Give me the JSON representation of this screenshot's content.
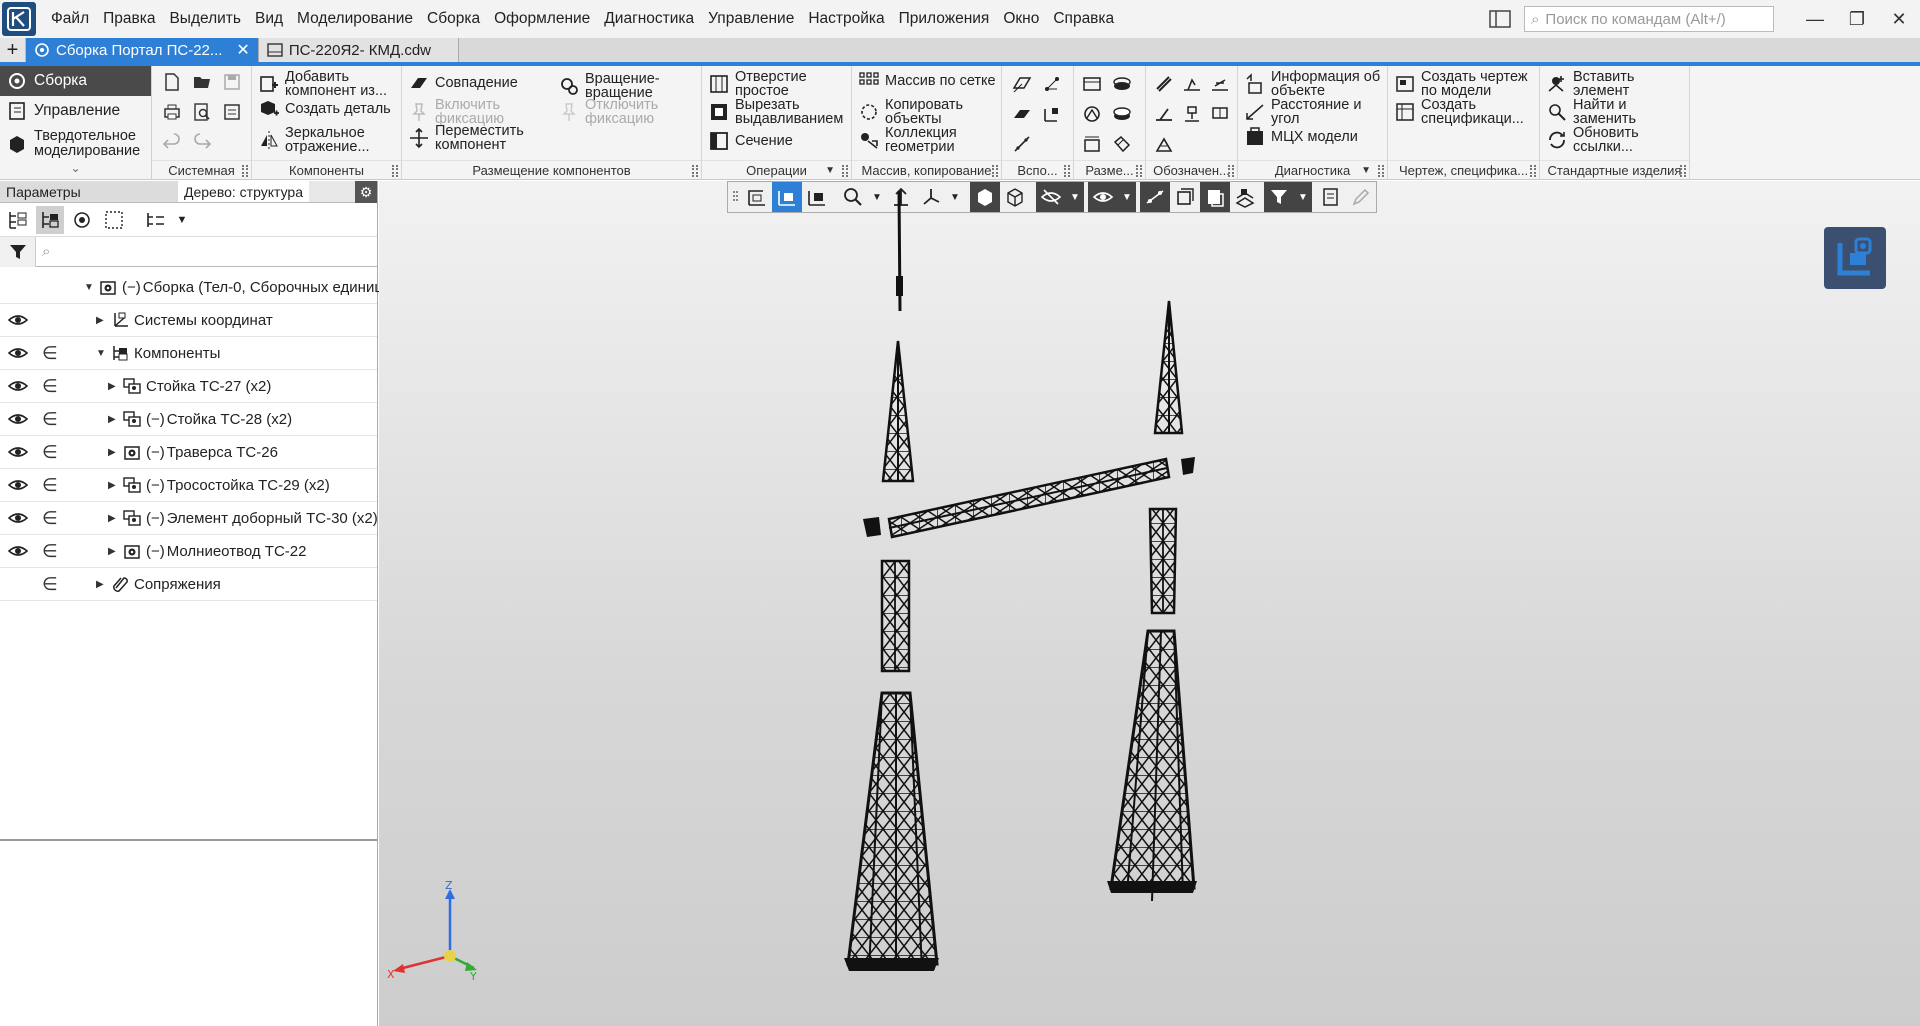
{
  "menu": [
    "Файл",
    "Правка",
    "Выделить",
    "Вид",
    "Моделирование",
    "Сборка",
    "Оформление",
    "Диагностика",
    "Управление",
    "Настройка",
    "Приложения",
    "Окно",
    "Справка"
  ],
  "search": {
    "placeholder": "Поиск по командам (Alt+/)"
  },
  "tabs": [
    {
      "label": "Сборка Портал ПС-22..."
    },
    {
      "label": "ПС-220Я2- КМД.cdw"
    }
  ],
  "modes": [
    {
      "label": "Сборка"
    },
    {
      "label": "Управление"
    },
    {
      "label": "Твердотельное моделирование"
    }
  ],
  "ribbon": {
    "groups": [
      "Системная",
      "Компоненты",
      "Размещение компонентов",
      "Операции",
      "Массив, копирование",
      "Вспо...",
      "Разме...",
      "Обозначен...",
      "Диагностика",
      "Чертеж, специфика...",
      "Стандартные изделия"
    ],
    "components": {
      "add": "Добавить компонент из...",
      "create_part": "Создать деталь",
      "mirror": "Зеркальное отражение..."
    },
    "placement": {
      "coincidence": "Совпадение",
      "enable_fix": "Включить фиксацию",
      "move": "Переместить компонент",
      "rotation": "Вращение-вращение",
      "disable_fix": "Отключить фиксацию"
    },
    "operations": {
      "hole": "Отверстие простое",
      "extrude_cut": "Вырезать выдавливанием",
      "section": "Сечение"
    },
    "array": {
      "grid": "Массив по сетке",
      "copy": "Копировать объекты",
      "collection": "Коллекция геометрии"
    },
    "diagnostics": {
      "info": "Информация об объекте",
      "distance": "Расстояние и угол",
      "mass": "МЦХ модели"
    },
    "drawing": {
      "create_drawing": "Создать чертеж по модели",
      "create_spec": "Создать спецификаци..."
    },
    "standard": {
      "insert": "Вставить элемент",
      "find_replace": "Найти и заменить",
      "update_links": "Обновить ссылки..."
    }
  },
  "left_panel": {
    "tab_params": "Параметры",
    "tab_tree": "Дерево: структура",
    "search_placeholder": "⌕"
  },
  "tree": [
    {
      "label": "Сборка (Тел-0, Сборочных единиц",
      "eye": false,
      "incl": false,
      "indent": 0,
      "minus": true,
      "icon": "assembly-icon"
    },
    {
      "label": "Системы координат",
      "eye": true,
      "incl": false,
      "indent": 1,
      "minus": false,
      "icon": "coordinate-system-icon"
    },
    {
      "label": "Компоненты",
      "eye": true,
      "incl": true,
      "indent": 1,
      "minus": false,
      "icon": "components-icon"
    },
    {
      "label": "Стойка ТС-27 (х2)",
      "eye": true,
      "incl": true,
      "indent": 2,
      "minus": false,
      "icon": "subassembly-icon"
    },
    {
      "label": "Стойка ТС-28 (х2)",
      "eye": true,
      "incl": true,
      "indent": 2,
      "minus": true,
      "icon": "subassembly-icon"
    },
    {
      "label": "Траверса ТС-26",
      "eye": true,
      "incl": true,
      "indent": 2,
      "minus": true,
      "icon": "assembly-icon"
    },
    {
      "label": "Тросостойка ТС-29 (х2)",
      "eye": true,
      "incl": true,
      "indent": 2,
      "minus": true,
      "icon": "subassembly-icon"
    },
    {
      "label": "Элемент доборный ТС-30 (х2)",
      "eye": true,
      "incl": true,
      "indent": 2,
      "minus": true,
      "icon": "subassembly-icon"
    },
    {
      "label": "Молниеотвод ТС-22",
      "eye": true,
      "incl": true,
      "indent": 2,
      "minus": true,
      "icon": "assembly-icon"
    },
    {
      "label": "Сопряжения",
      "eye": false,
      "incl": true,
      "indent": 1,
      "minus": false,
      "icon": "mates-icon"
    }
  ],
  "axes": {
    "x": "X",
    "y": "Y",
    "z": "Z"
  },
  "colors": {
    "accent": "#2e7fd6",
    "dark": "#4a4a4a",
    "model": "#111111"
  }
}
